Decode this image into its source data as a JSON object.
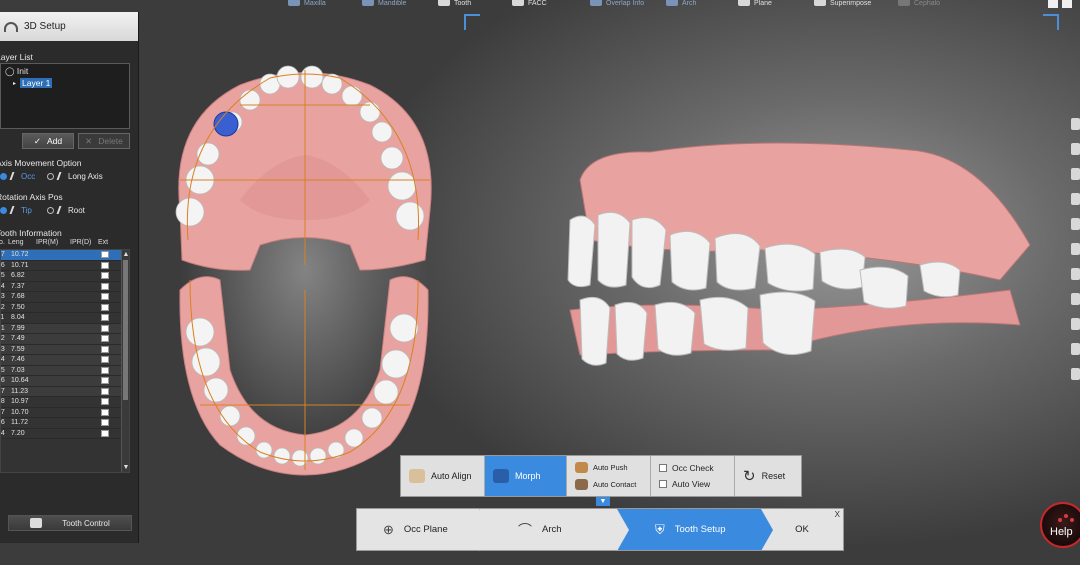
{
  "top_bar": {
    "items": [
      {
        "label": "Maxilla",
        "style": "blue"
      },
      {
        "label": "Mandible",
        "style": "blue"
      },
      {
        "label": "Tooth",
        "style": "white"
      },
      {
        "label": "FACC",
        "style": "white"
      },
      {
        "label": "Overlap Info",
        "style": "blue"
      },
      {
        "label": "Arch",
        "style": "blue"
      },
      {
        "label": "Plane",
        "style": "white"
      },
      {
        "label": "Superimpose",
        "style": "white"
      },
      {
        "label": "Cephalo",
        "style": "dim"
      }
    ]
  },
  "left_panel": {
    "title": "3D Setup",
    "layer_list_label": "Layer List",
    "layers": {
      "root": "Init",
      "child": "Layer 1"
    },
    "add_label": "Add",
    "delete_label": "Delete",
    "axis_movement_label": "Axis Movement Option",
    "axis_options": [
      "Occ",
      "Long Axis"
    ],
    "rotation_axis_label": "Rotation Axis Pos",
    "rotation_options": [
      "Tip",
      "Root"
    ],
    "tooth_info_label": "Tooth Information",
    "columns": [
      "No.",
      "Leng",
      "IPR(M)",
      "IPR(D)",
      "Ext"
    ],
    "rows": [
      {
        "no": "17",
        "leng": "10.72"
      },
      {
        "no": "16",
        "leng": "10.71"
      },
      {
        "no": "15",
        "leng": "6.82"
      },
      {
        "no": "14",
        "leng": "7.37"
      },
      {
        "no": "13",
        "leng": "7.68"
      },
      {
        "no": "12",
        "leng": "7.50"
      },
      {
        "no": "11",
        "leng": "8.04"
      },
      {
        "no": "21",
        "leng": "7.99"
      },
      {
        "no": "22",
        "leng": "7.49"
      },
      {
        "no": "23",
        "leng": "7.59"
      },
      {
        "no": "24",
        "leng": "7.46"
      },
      {
        "no": "25",
        "leng": "7.03"
      },
      {
        "no": "26",
        "leng": "10.64"
      },
      {
        "no": "27",
        "leng": "11.23"
      },
      {
        "no": "38",
        "leng": "10.97"
      },
      {
        "no": "37",
        "leng": "10.70"
      },
      {
        "no": "36",
        "leng": "11.72"
      },
      {
        "no": "34",
        "leng": "7.20"
      }
    ],
    "tooth_control_label": "Tooth Control"
  },
  "tool_strip": {
    "auto_align": "Auto Align",
    "morph": "Morph",
    "auto_push": "Auto Push",
    "auto_contact": "Auto Contact",
    "occ_check": "Occ Check",
    "auto_view": "Auto View",
    "reset": "Reset"
  },
  "wizard": {
    "steps": [
      "Occ Plane",
      "Arch",
      "Tooth Setup"
    ],
    "ok": "OK",
    "close": "X"
  },
  "help_label": "Help",
  "colors": {
    "accent": "#3a8ae0",
    "gum": "#e8a0a0",
    "tooth": "#f2f2f2",
    "selected_tooth": "#3a5fd0",
    "help_ring": "#c8282a"
  }
}
